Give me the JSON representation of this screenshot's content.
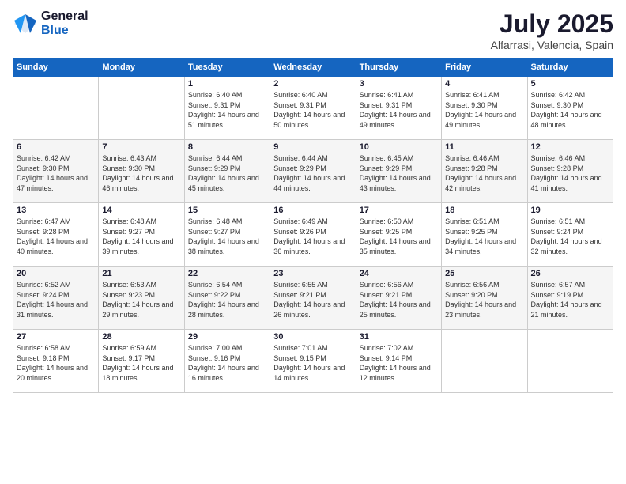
{
  "header": {
    "logo_general": "General",
    "logo_blue": "Blue",
    "month_title": "July 2025",
    "location": "Alfarrasi, Valencia, Spain"
  },
  "weekdays": [
    "Sunday",
    "Monday",
    "Tuesday",
    "Wednesday",
    "Thursday",
    "Friday",
    "Saturday"
  ],
  "weeks": [
    [
      {
        "day": "",
        "sunrise": "",
        "sunset": "",
        "daylight": ""
      },
      {
        "day": "",
        "sunrise": "",
        "sunset": "",
        "daylight": ""
      },
      {
        "day": "1",
        "sunrise": "Sunrise: 6:40 AM",
        "sunset": "Sunset: 9:31 PM",
        "daylight": "Daylight: 14 hours and 51 minutes."
      },
      {
        "day": "2",
        "sunrise": "Sunrise: 6:40 AM",
        "sunset": "Sunset: 9:31 PM",
        "daylight": "Daylight: 14 hours and 50 minutes."
      },
      {
        "day": "3",
        "sunrise": "Sunrise: 6:41 AM",
        "sunset": "Sunset: 9:31 PM",
        "daylight": "Daylight: 14 hours and 49 minutes."
      },
      {
        "day": "4",
        "sunrise": "Sunrise: 6:41 AM",
        "sunset": "Sunset: 9:30 PM",
        "daylight": "Daylight: 14 hours and 49 minutes."
      },
      {
        "day": "5",
        "sunrise": "Sunrise: 6:42 AM",
        "sunset": "Sunset: 9:30 PM",
        "daylight": "Daylight: 14 hours and 48 minutes."
      }
    ],
    [
      {
        "day": "6",
        "sunrise": "Sunrise: 6:42 AM",
        "sunset": "Sunset: 9:30 PM",
        "daylight": "Daylight: 14 hours and 47 minutes."
      },
      {
        "day": "7",
        "sunrise": "Sunrise: 6:43 AM",
        "sunset": "Sunset: 9:30 PM",
        "daylight": "Daylight: 14 hours and 46 minutes."
      },
      {
        "day": "8",
        "sunrise": "Sunrise: 6:44 AM",
        "sunset": "Sunset: 9:29 PM",
        "daylight": "Daylight: 14 hours and 45 minutes."
      },
      {
        "day": "9",
        "sunrise": "Sunrise: 6:44 AM",
        "sunset": "Sunset: 9:29 PM",
        "daylight": "Daylight: 14 hours and 44 minutes."
      },
      {
        "day": "10",
        "sunrise": "Sunrise: 6:45 AM",
        "sunset": "Sunset: 9:29 PM",
        "daylight": "Daylight: 14 hours and 43 minutes."
      },
      {
        "day": "11",
        "sunrise": "Sunrise: 6:46 AM",
        "sunset": "Sunset: 9:28 PM",
        "daylight": "Daylight: 14 hours and 42 minutes."
      },
      {
        "day": "12",
        "sunrise": "Sunrise: 6:46 AM",
        "sunset": "Sunset: 9:28 PM",
        "daylight": "Daylight: 14 hours and 41 minutes."
      }
    ],
    [
      {
        "day": "13",
        "sunrise": "Sunrise: 6:47 AM",
        "sunset": "Sunset: 9:28 PM",
        "daylight": "Daylight: 14 hours and 40 minutes."
      },
      {
        "day": "14",
        "sunrise": "Sunrise: 6:48 AM",
        "sunset": "Sunset: 9:27 PM",
        "daylight": "Daylight: 14 hours and 39 minutes."
      },
      {
        "day": "15",
        "sunrise": "Sunrise: 6:48 AM",
        "sunset": "Sunset: 9:27 PM",
        "daylight": "Daylight: 14 hours and 38 minutes."
      },
      {
        "day": "16",
        "sunrise": "Sunrise: 6:49 AM",
        "sunset": "Sunset: 9:26 PM",
        "daylight": "Daylight: 14 hours and 36 minutes."
      },
      {
        "day": "17",
        "sunrise": "Sunrise: 6:50 AM",
        "sunset": "Sunset: 9:25 PM",
        "daylight": "Daylight: 14 hours and 35 minutes."
      },
      {
        "day": "18",
        "sunrise": "Sunrise: 6:51 AM",
        "sunset": "Sunset: 9:25 PM",
        "daylight": "Daylight: 14 hours and 34 minutes."
      },
      {
        "day": "19",
        "sunrise": "Sunrise: 6:51 AM",
        "sunset": "Sunset: 9:24 PM",
        "daylight": "Daylight: 14 hours and 32 minutes."
      }
    ],
    [
      {
        "day": "20",
        "sunrise": "Sunrise: 6:52 AM",
        "sunset": "Sunset: 9:24 PM",
        "daylight": "Daylight: 14 hours and 31 minutes."
      },
      {
        "day": "21",
        "sunrise": "Sunrise: 6:53 AM",
        "sunset": "Sunset: 9:23 PM",
        "daylight": "Daylight: 14 hours and 29 minutes."
      },
      {
        "day": "22",
        "sunrise": "Sunrise: 6:54 AM",
        "sunset": "Sunset: 9:22 PM",
        "daylight": "Daylight: 14 hours and 28 minutes."
      },
      {
        "day": "23",
        "sunrise": "Sunrise: 6:55 AM",
        "sunset": "Sunset: 9:21 PM",
        "daylight": "Daylight: 14 hours and 26 minutes."
      },
      {
        "day": "24",
        "sunrise": "Sunrise: 6:56 AM",
        "sunset": "Sunset: 9:21 PM",
        "daylight": "Daylight: 14 hours and 25 minutes."
      },
      {
        "day": "25",
        "sunrise": "Sunrise: 6:56 AM",
        "sunset": "Sunset: 9:20 PM",
        "daylight": "Daylight: 14 hours and 23 minutes."
      },
      {
        "day": "26",
        "sunrise": "Sunrise: 6:57 AM",
        "sunset": "Sunset: 9:19 PM",
        "daylight": "Daylight: 14 hours and 21 minutes."
      }
    ],
    [
      {
        "day": "27",
        "sunrise": "Sunrise: 6:58 AM",
        "sunset": "Sunset: 9:18 PM",
        "daylight": "Daylight: 14 hours and 20 minutes."
      },
      {
        "day": "28",
        "sunrise": "Sunrise: 6:59 AM",
        "sunset": "Sunset: 9:17 PM",
        "daylight": "Daylight: 14 hours and 18 minutes."
      },
      {
        "day": "29",
        "sunrise": "Sunrise: 7:00 AM",
        "sunset": "Sunset: 9:16 PM",
        "daylight": "Daylight: 14 hours and 16 minutes."
      },
      {
        "day": "30",
        "sunrise": "Sunrise: 7:01 AM",
        "sunset": "Sunset: 9:15 PM",
        "daylight": "Daylight: 14 hours and 14 minutes."
      },
      {
        "day": "31",
        "sunrise": "Sunrise: 7:02 AM",
        "sunset": "Sunset: 9:14 PM",
        "daylight": "Daylight: 14 hours and 12 minutes."
      },
      {
        "day": "",
        "sunrise": "",
        "sunset": "",
        "daylight": ""
      },
      {
        "day": "",
        "sunrise": "",
        "sunset": "",
        "daylight": ""
      }
    ]
  ]
}
